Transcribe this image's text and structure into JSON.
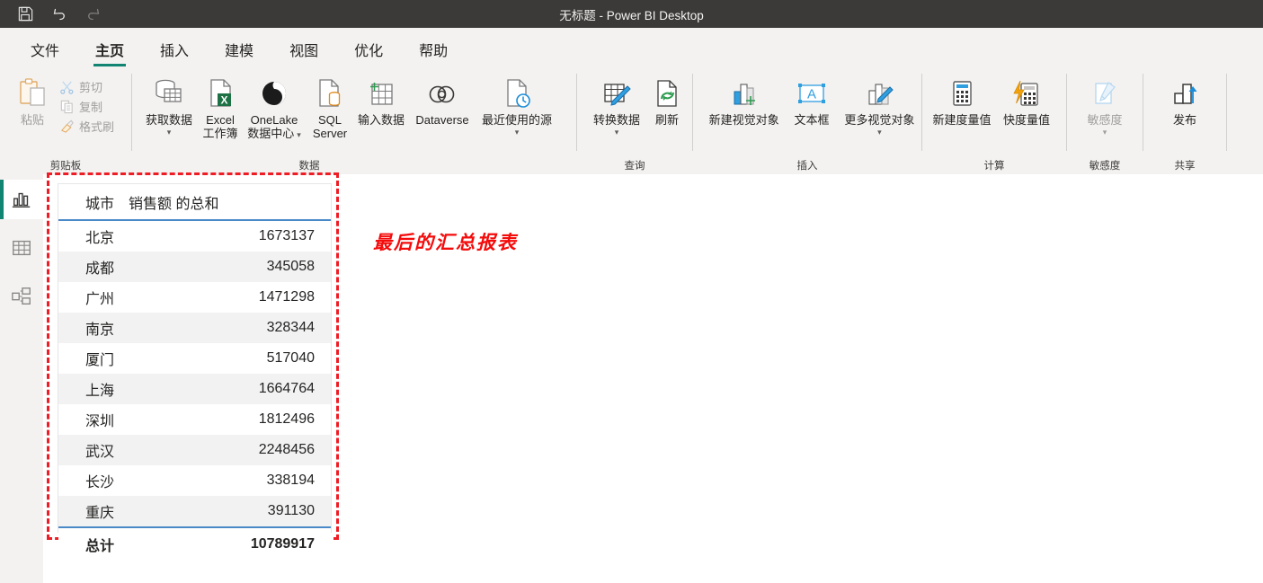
{
  "titlebar": {
    "title": "无标题 - Power BI Desktop",
    "quick_access": [
      {
        "name": "save-icon",
        "label": "保存"
      },
      {
        "name": "undo-icon",
        "label": "撤消"
      },
      {
        "name": "redo-icon",
        "label": "恢复"
      }
    ]
  },
  "tabs": [
    {
      "label": "文件",
      "active": false
    },
    {
      "label": "主页",
      "active": true
    },
    {
      "label": "插入",
      "active": false
    },
    {
      "label": "建模",
      "active": false
    },
    {
      "label": "视图",
      "active": false
    },
    {
      "label": "优化",
      "active": false
    },
    {
      "label": "帮助",
      "active": false
    }
  ],
  "ribbon": {
    "clipboard": {
      "group_label": "剪贴板",
      "paste": "粘贴",
      "cut": "剪切",
      "copy": "复制",
      "format_painter": "格式刷"
    },
    "data": {
      "group_label": "数据",
      "get_data": "获取数据",
      "excel_line1": "Excel",
      "excel_line2": "工作簿",
      "onelake_line1": "OneLake",
      "onelake_line2": "数据中心",
      "sql_line1": "SQL",
      "sql_line2": "Server",
      "enter_data": "输入数据",
      "dataverse": "Dataverse",
      "recent_sources": "最近使用的源"
    },
    "query": {
      "group_label": "查询",
      "transform_data": "转换数据",
      "refresh": "刷新"
    },
    "insert": {
      "group_label": "插入",
      "new_visual": "新建视觉对象",
      "text_box": "文本框",
      "more_visuals": "更多视觉对象"
    },
    "calculations": {
      "group_label": "计算",
      "new_measure": "新建度量值",
      "quick_measure": "快度量值"
    },
    "sensitivity": {
      "group_label": "敏感度",
      "sensitivity": "敏感度"
    },
    "share": {
      "group_label": "共享",
      "publish": "发布"
    }
  },
  "leftnav": {
    "items": [
      {
        "name": "report-view",
        "label": "报表视图",
        "active": true
      },
      {
        "name": "data-view",
        "label": "数据视图",
        "active": false
      },
      {
        "name": "model-view",
        "label": "模型视图",
        "active": false
      }
    ]
  },
  "canvas": {
    "annotation_text": "最后的汇总报表",
    "annotation_color": "#f40b0b",
    "highlight_border_color": "#ee1c25",
    "visual": {
      "headers": [
        "城市",
        "销售额 的总和"
      ],
      "rows": [
        {
          "city": "北京",
          "value": "1673137"
        },
        {
          "city": "成都",
          "value": "345058"
        },
        {
          "city": "广州",
          "value": "1471298"
        },
        {
          "city": "南京",
          "value": "328344"
        },
        {
          "city": "厦门",
          "value": "517040"
        },
        {
          "city": "上海",
          "value": "1664764"
        },
        {
          "city": "深圳",
          "value": "1812496"
        },
        {
          "city": "武汉",
          "value": "2248456"
        },
        {
          "city": "长沙",
          "value": "338194"
        },
        {
          "city": "重庆",
          "value": "391130"
        }
      ],
      "total_label": "总计",
      "total_value": "10789917"
    }
  },
  "chart_data": {
    "type": "table",
    "title": "销售额 的总和",
    "categories": [
      "北京",
      "成都",
      "广州",
      "南京",
      "厦门",
      "上海",
      "深圳",
      "武汉",
      "长沙",
      "重庆"
    ],
    "values": [
      1673137,
      345058,
      1471298,
      328344,
      517040,
      1664764,
      1812496,
      2248456,
      338194,
      391130
    ],
    "xlabel": "城市",
    "ylabel": "销售额 的总和",
    "total": 10789917
  }
}
